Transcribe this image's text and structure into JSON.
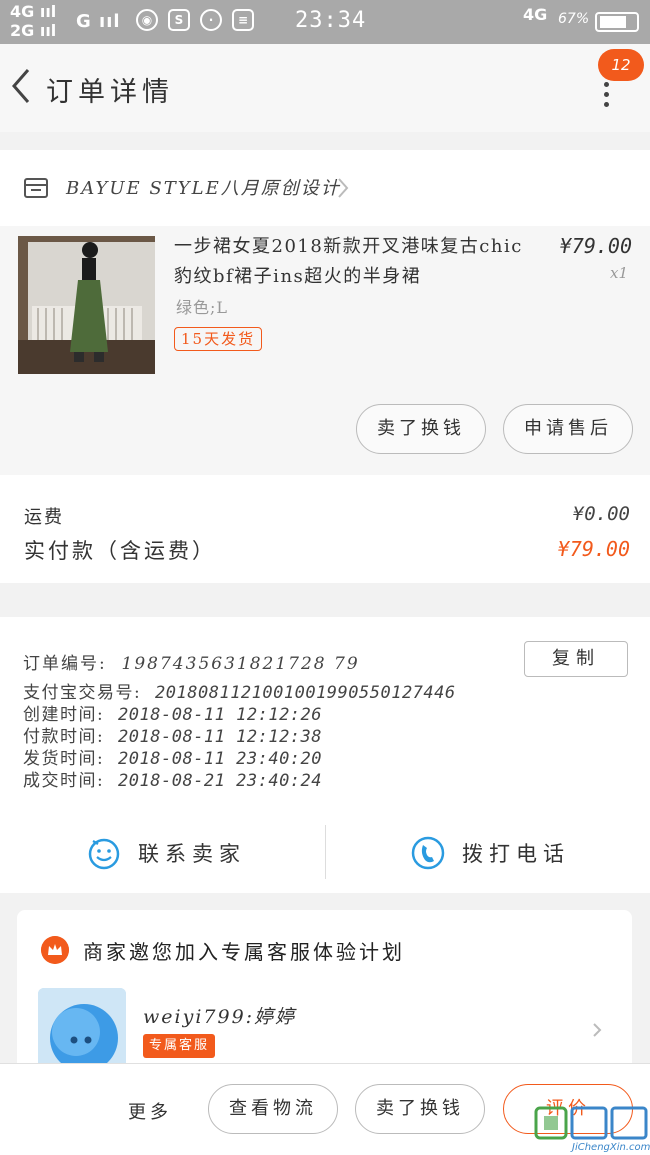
{
  "statusbar": {
    "left_top": "4G",
    "left_bottom": "2G",
    "signal": "G",
    "time": "23:34",
    "net": "4G",
    "battery": "67%",
    "icons": [
      "netease-icon",
      "sim-icon",
      "hotspot-icon",
      "data-icon"
    ]
  },
  "header": {
    "title": "订单详情",
    "badge_count": "12"
  },
  "shop": {
    "name": "BAYUE STYLE八月原创设计"
  },
  "product": {
    "title": "一步裙女夏2018新款开叉港味复古chic豹纹bf裙子ins超火的半身裙",
    "sku": "绿色;L",
    "tag": "15天发货",
    "price": "¥79.00",
    "qty": "x1",
    "actions": [
      "卖了换钱",
      "申请售后"
    ]
  },
  "fees": {
    "shipping_label": "运费",
    "shipping_value": "¥0.00",
    "paid_label": "实付款（含运费）",
    "paid_value": "¥79.00"
  },
  "order_info": {
    "order_no_label": "订单编号:",
    "order_no": "1987435631821728 79",
    "copy_label": "复制",
    "rows": [
      {
        "label": "支付宝交易号:",
        "value": "2018081121001001990550127446"
      },
      {
        "label": "创建时间:",
        "value": "2018-08-11  12:12:26"
      },
      {
        "label": "付款时间:",
        "value": "2018-08-11  12:12:38"
      },
      {
        "label": "发货时间:",
        "value": "2018-08-11  23:40:20"
      },
      {
        "label": "成交时间:",
        "value": "2018-08-21  23:40:24"
      }
    ],
    "contact_seller": "联系卖家",
    "call_phone": "拨打电话"
  },
  "invite": {
    "title": "商家邀您加入专属客服体验计划",
    "agent_name": "weiyi799:婷婷",
    "agent_tag": "专属客服"
  },
  "bottombar": {
    "more": "更多",
    "logistics": "查看物流",
    "swap": "卖了换钱",
    "review": "评价"
  },
  "watermark": {
    "text": "JiChengXin.com"
  },
  "colors": {
    "accent": "#f25a1c",
    "statusbar": "#a9a9a9",
    "icon_blue": "#2a9be0"
  }
}
